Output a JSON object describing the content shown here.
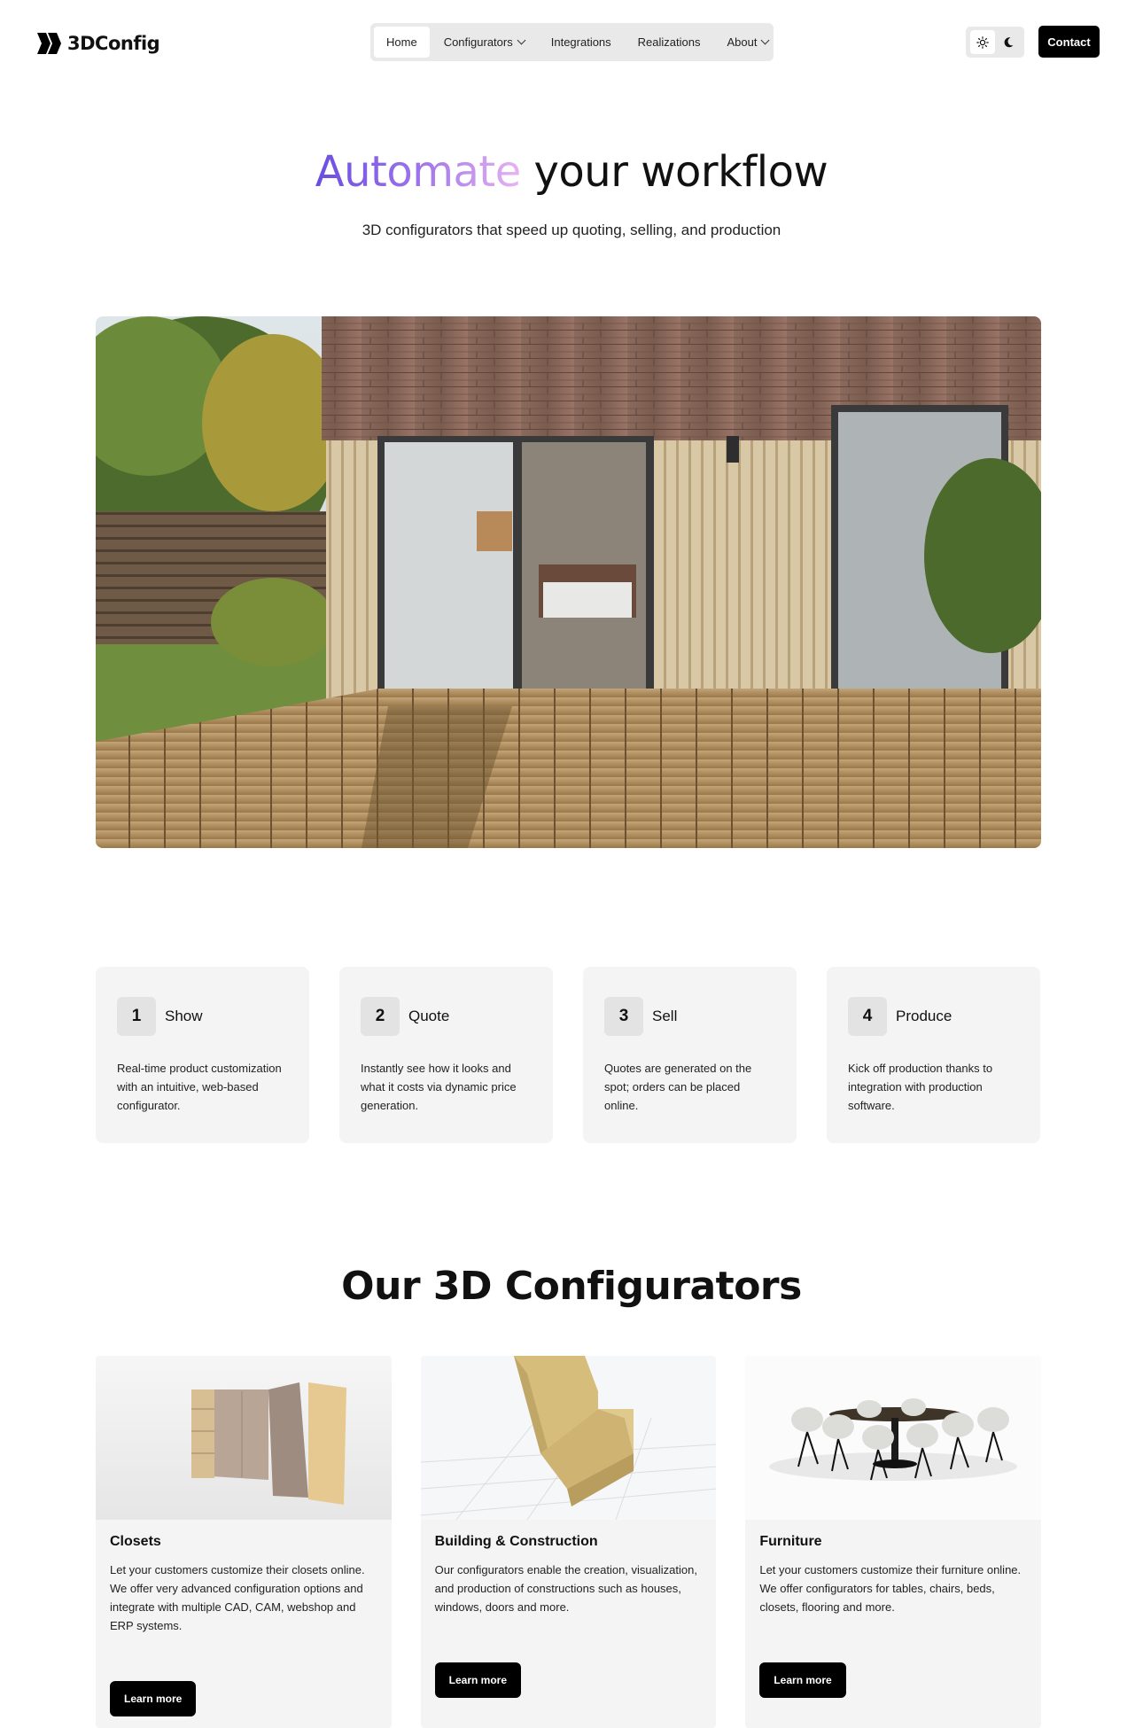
{
  "header": {
    "logo_text": "3DConfig",
    "nav": [
      {
        "label": "Home",
        "active": true,
        "dropdown": false
      },
      {
        "label": "Configurators",
        "active": false,
        "dropdown": true
      },
      {
        "label": "Integrations",
        "active": false,
        "dropdown": false
      },
      {
        "label": "Realizations",
        "active": false,
        "dropdown": false
      },
      {
        "label": "About",
        "active": false,
        "dropdown": true
      }
    ],
    "theme_icons": [
      "sun-icon",
      "moon-icon"
    ],
    "contact_label": "Contact"
  },
  "hero": {
    "title_highlight": "Automate",
    "title_rest": "your workflow",
    "subtitle": "3D configurators that speed up quoting, selling, and production"
  },
  "steps": [
    {
      "num": "1",
      "title": "Show",
      "text": "Real-time product customization with an intuitive, web-based configurator."
    },
    {
      "num": "2",
      "title": "Quote",
      "text": "Instantly see how it looks and what it costs via dynamic price generation."
    },
    {
      "num": "3",
      "title": "Sell",
      "text": "Quotes are generated on the spot; orders can be placed online."
    },
    {
      "num": "4",
      "title": "Produce",
      "text": "Kick off production thanks to integration with production software."
    }
  ],
  "configurators": {
    "title": "Our 3D Configurators",
    "cards": [
      {
        "title": "Closets",
        "text": "Let your customers customize their closets online. We offer very advanced configuration options and integrate with multiple CAD, CAM, webshop and ERP systems.",
        "button": "Learn more"
      },
      {
        "title": "Building & Construction",
        "text": "Our configurators enable the creation, visualization, and production of constructions such as houses, windows, doors and more.",
        "button": "Learn more"
      },
      {
        "title": "Furniture",
        "text": "Let your customers customize their furniture online. We offer configurators for tables, chairs, beds, closets, flooring and more.",
        "button": "Learn more"
      }
    ]
  },
  "colors": {
    "accent_start": "#6a4ee0",
    "accent_end": "#e8b4f0",
    "button": "#000000",
    "card_bg": "#f4f4f4"
  }
}
